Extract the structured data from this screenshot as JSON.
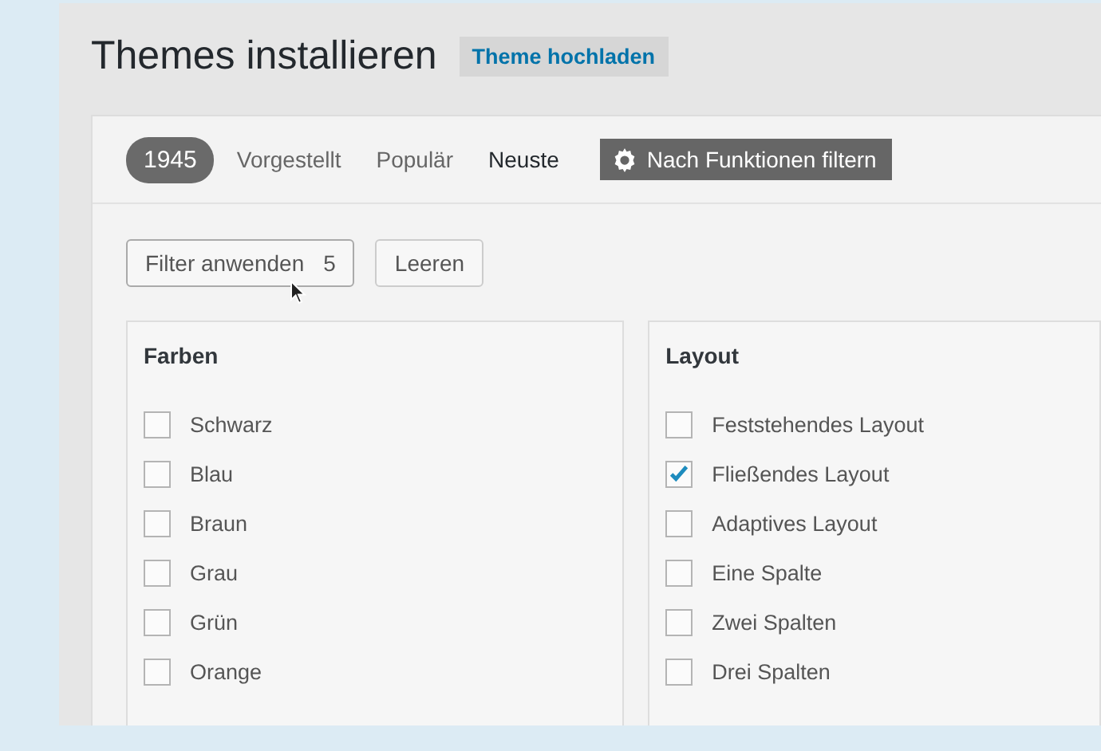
{
  "page": {
    "title": "Themes installieren",
    "upload_button": "Theme hochladen"
  },
  "filter_bar": {
    "count": "1945",
    "tabs": [
      {
        "label": "Vorgestellt",
        "selected": false
      },
      {
        "label": "Populär",
        "selected": false
      },
      {
        "label": "Neuste",
        "selected": true
      }
    ],
    "feature_filter_button": "Nach Funktionen filtern"
  },
  "actions": {
    "apply_button": {
      "label": "Filter anwenden",
      "count": "5"
    },
    "clear_button": "Leeren"
  },
  "groups": [
    {
      "title": "Farben",
      "options": [
        {
          "label": "Schwarz",
          "checked": false
        },
        {
          "label": "Blau",
          "checked": false
        },
        {
          "label": "Braun",
          "checked": false
        },
        {
          "label": "Grau",
          "checked": false
        },
        {
          "label": "Grün",
          "checked": false
        },
        {
          "label": "Orange",
          "checked": false
        }
      ]
    },
    {
      "title": "Layout",
      "options": [
        {
          "label": "Feststehendes Layout",
          "checked": false
        },
        {
          "label": "Fließendes Layout",
          "checked": true
        },
        {
          "label": "Adaptives Layout",
          "checked": false
        },
        {
          "label": "Eine Spalte",
          "checked": false
        },
        {
          "label": "Zwei Spalten",
          "checked": false
        },
        {
          "label": "Drei Spalten",
          "checked": false
        }
      ]
    }
  ]
}
